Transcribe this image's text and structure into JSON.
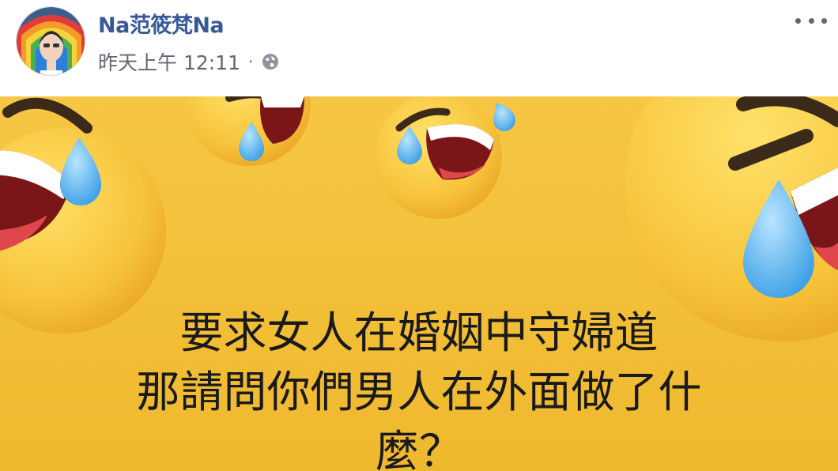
{
  "post": {
    "author_name": "Na范筱梵Na",
    "timestamp": "昨天上午 12:11",
    "separator": "·",
    "privacy_icon": "globe-icon",
    "more_icon": "more-options-icon"
  },
  "image": {
    "caption_lines": [
      "要求女人在婚姻中守婦道",
      "那請問你們男人在外面做了什",
      "麼？"
    ],
    "background_color": "#f4c23c"
  }
}
